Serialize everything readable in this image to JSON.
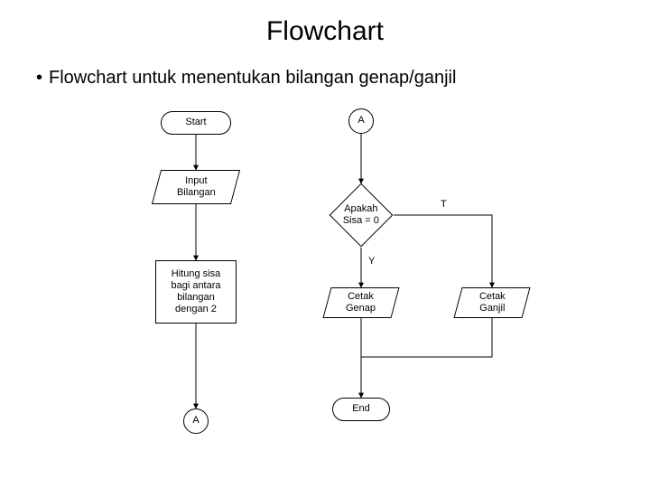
{
  "title": "Flowchart",
  "bullet": "Flowchart untuk menentukan bilangan genap/ganjil",
  "nodes": {
    "start": "Start",
    "input": "Input\nBilangan",
    "process": "Hitung sisa\nbagi antara\nbilangan\ndengan 2",
    "conn_a_bottom": "A",
    "conn_a_top": "A",
    "decision": "Apakah\nSisa = 0",
    "cetak_genap": "Cetak\nGenap",
    "cetak_ganjil": "Cetak\nGanjil",
    "end": "End"
  },
  "labels": {
    "true": "T",
    "yes": "Y"
  }
}
